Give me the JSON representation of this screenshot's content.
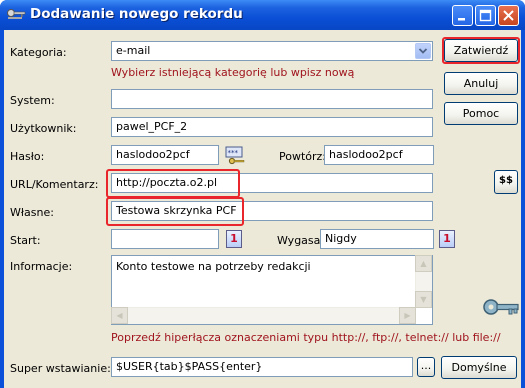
{
  "window": {
    "title": "Dodawanie nowego rekordu"
  },
  "labels": {
    "kategoria": "Kategoria:",
    "system": "System:",
    "uzytkownik": "Użytkownik:",
    "haslo": "Hasło:",
    "powtorz": "Powtórz:",
    "url": "URL/Komentarz:",
    "wlasne": "Własne:",
    "start": "Start:",
    "wygasa": "Wygasa:",
    "informacje": "Informacje:",
    "super": "Super wstawianie:"
  },
  "fields": {
    "kategoria": "e-mail",
    "system": "",
    "uzytkownik": "pawel_PCF_2",
    "haslo": "haslodoo2pcf",
    "powtorz": "haslodoo2pcf",
    "url": "http://poczta.o2.pl",
    "wlasne": "Testowa skrzynka PCF",
    "start": "",
    "wygasa": "Nigdy",
    "informacje": "Konto testowe na potrzeby redakcji",
    "super": "$USER{tab}$PASS{enter}"
  },
  "hints": {
    "kategoria": "Wybierz istniejącą kategorię lub wpisz nową",
    "informacje": "Poprzedź hiperłącza oznaczeniami typu http://, ftp://, telnet:// lub file://"
  },
  "buttons": {
    "zatwierdz": "Zatwierdź",
    "anuluj": "Anuluj",
    "pomoc": "Pomoc",
    "ellipsis": "...",
    "domyslne": "Domyślne",
    "cal_glyph": "1",
    "sub_glyph": "$$"
  },
  "icons": [
    "keys-icon",
    "password-generator-icon",
    "calendar-icon",
    "macro-icon",
    "key-icon"
  ],
  "colors": {
    "title_bar": "#0a4fd6",
    "dialog_bg": "#ece9d8",
    "hint_text": "#a0141e",
    "highlight_box": "#e8262c"
  }
}
